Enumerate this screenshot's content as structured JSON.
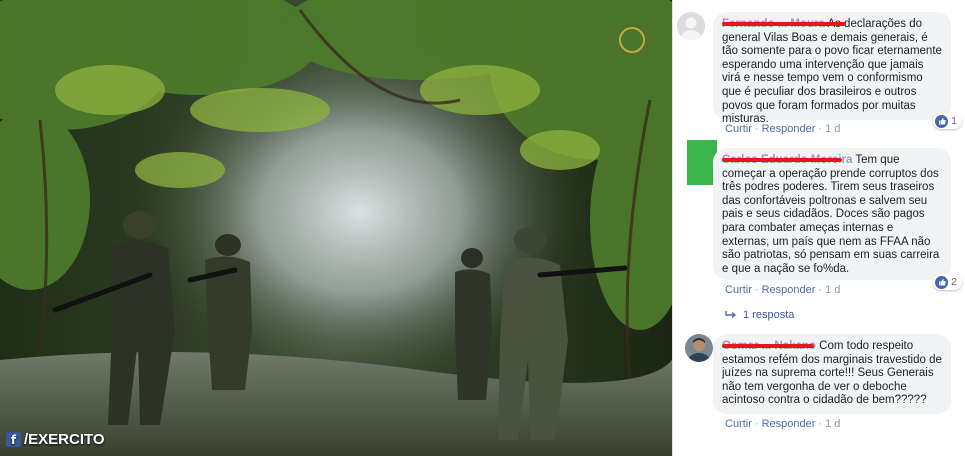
{
  "photo": {
    "watermark_text": "/EXERCITO",
    "watermark_icon": "facebook-icon"
  },
  "comments": [
    {
      "author": "Fernando ... Moura",
      "text": "As declarações do general Vilas Boas e demais generais, é tão somente para o povo ficar eternamente esperando uma intervenção que jamais virá e nesse tempo vem o conformismo que é peculiar dos brasileiros e outros povos que foram formados por muitas misturas.",
      "like_label": "Curtir",
      "reply_label": "Responder",
      "time": "1 d",
      "reactions": "1"
    },
    {
      "author": "Carlos Eduardo Moreira",
      "text": "Tem que começar a operação prende corruptos dos três podres poderes. Tirem seus traseiros das confortáveis poltronas e salvem seu pais e seus cidadãos. Doces são pagos para combater ameças internas e externas, um país que nem as FFAA não são patriotas, só pensam em suas carreira e que a nação se fo%da.",
      "like_label": "Curtir",
      "reply_label": "Responder",
      "time": "1 d",
      "reactions": "2",
      "replies_label": "1 resposta"
    },
    {
      "author": "Osmar ... Nakano",
      "text": "Com todo respeito estamos refém dos marginais travestido de juízes na suprema corte!!! Seus Generais não tem vergonha de ver o deboche acintoso contra o cidadão de bem?????",
      "like_label": "Curtir",
      "reply_label": "Responder",
      "time": "1 d"
    }
  ],
  "colors": {
    "link": "#385898",
    "bubble": "#f2f3f5",
    "redaction": "#e8151b",
    "avatar_green": "#3cb54a"
  }
}
